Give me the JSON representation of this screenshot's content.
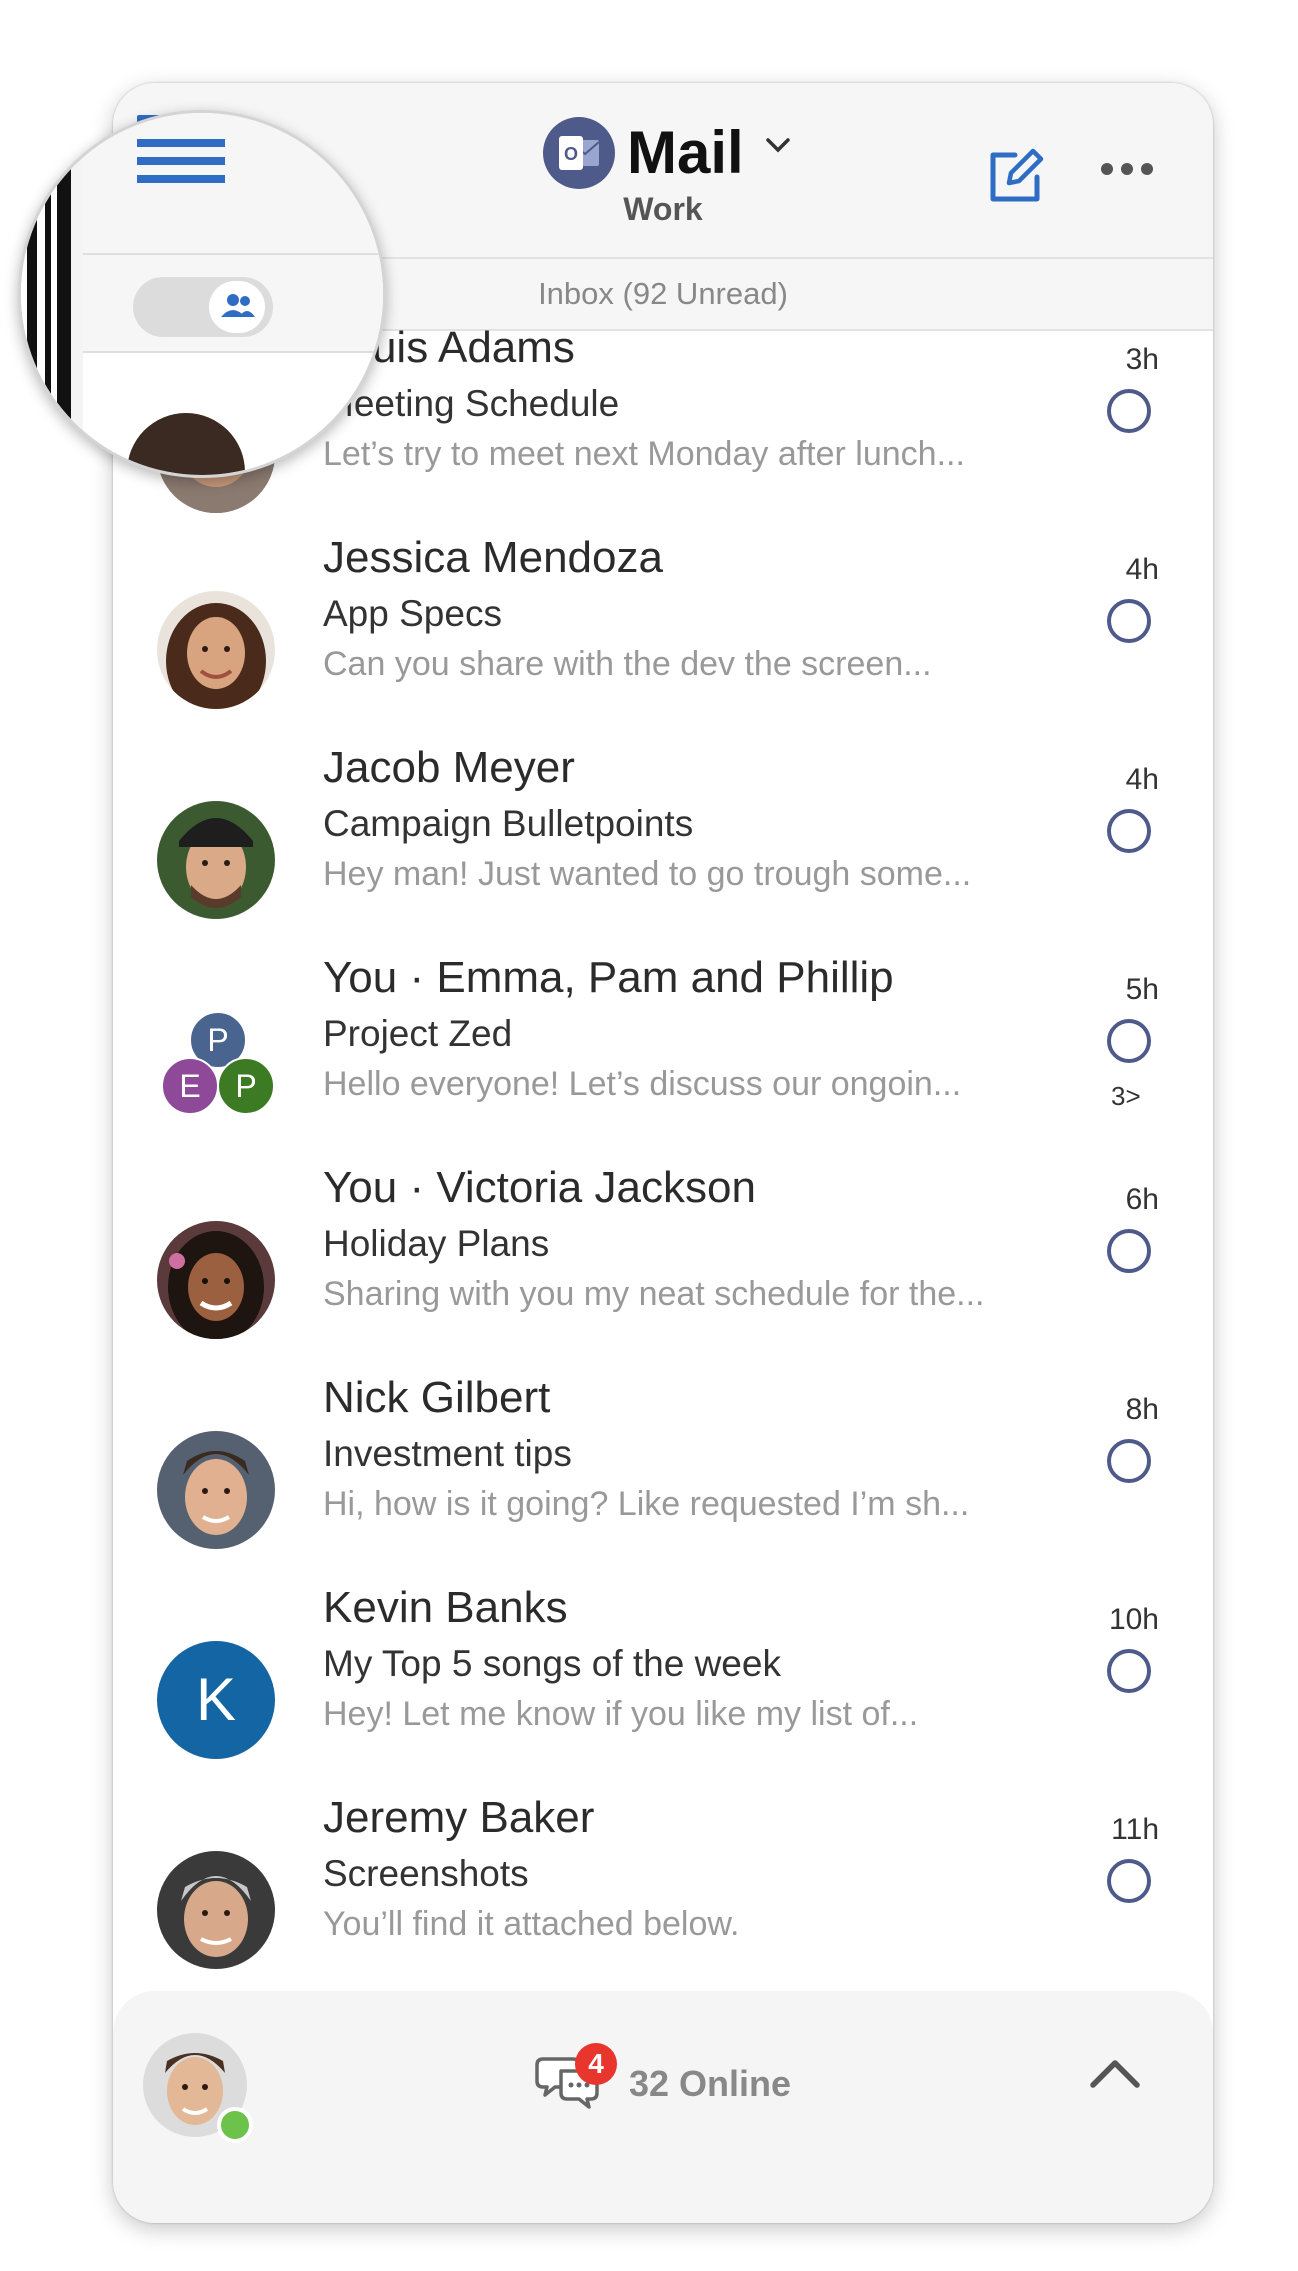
{
  "header": {
    "title": "Mail",
    "account": "Work",
    "app_icon_letter": "O"
  },
  "inbox": {
    "label": "Inbox (92 Unread)"
  },
  "emails": [
    {
      "sender": "Louis Adams",
      "subject": "Meeting Schedule",
      "preview": "Let’s try to meet next Monday after lunch...",
      "time": "3h"
    },
    {
      "sender": "Jessica Mendoza",
      "subject": "App Specs",
      "preview": "Can you share with the dev the screen...",
      "time": "4h"
    },
    {
      "sender": "Jacob Meyer",
      "subject": "Campaign Bulletpoints",
      "preview": "Hey man! Just wanted to go trough some...",
      "time": "4h"
    },
    {
      "sender": "You · Emma, Pam and Phillip",
      "subject": "Project Zed",
      "preview": "Hello everyone! Let’s discuss our ongoin...",
      "time": "5h",
      "thread_count": "3>",
      "group_initials": [
        "P",
        "E",
        "P"
      ]
    },
    {
      "sender": "You · Victoria Jackson",
      "subject": "Holiday Plans",
      "preview": "Sharing with you my neat schedule for the...",
      "time": "6h"
    },
    {
      "sender": "Nick Gilbert",
      "subject": "Investment tips",
      "preview": "Hi, how is it going? Like requested I’m sh...",
      "time": "8h"
    },
    {
      "sender": "Kevin Banks",
      "subject": "My Top 5 songs of the week",
      "preview": "Hey! Let me know if you like my list of...",
      "time": "10h",
      "initial": "K"
    },
    {
      "sender": "Jeremy Baker",
      "subject": "Screenshots",
      "preview": "You’ll find it attached below.",
      "time": "11h"
    }
  ],
  "bottom_bar": {
    "chat_badge": "4",
    "online_label": "32 Online"
  },
  "colors": {
    "accent_blue": "#2f6dc5",
    "unread_circle": "#4e5a8a",
    "badge_red": "#e8352e",
    "presence_green": "#6cc24a",
    "k_avatar": "#1465a3"
  }
}
